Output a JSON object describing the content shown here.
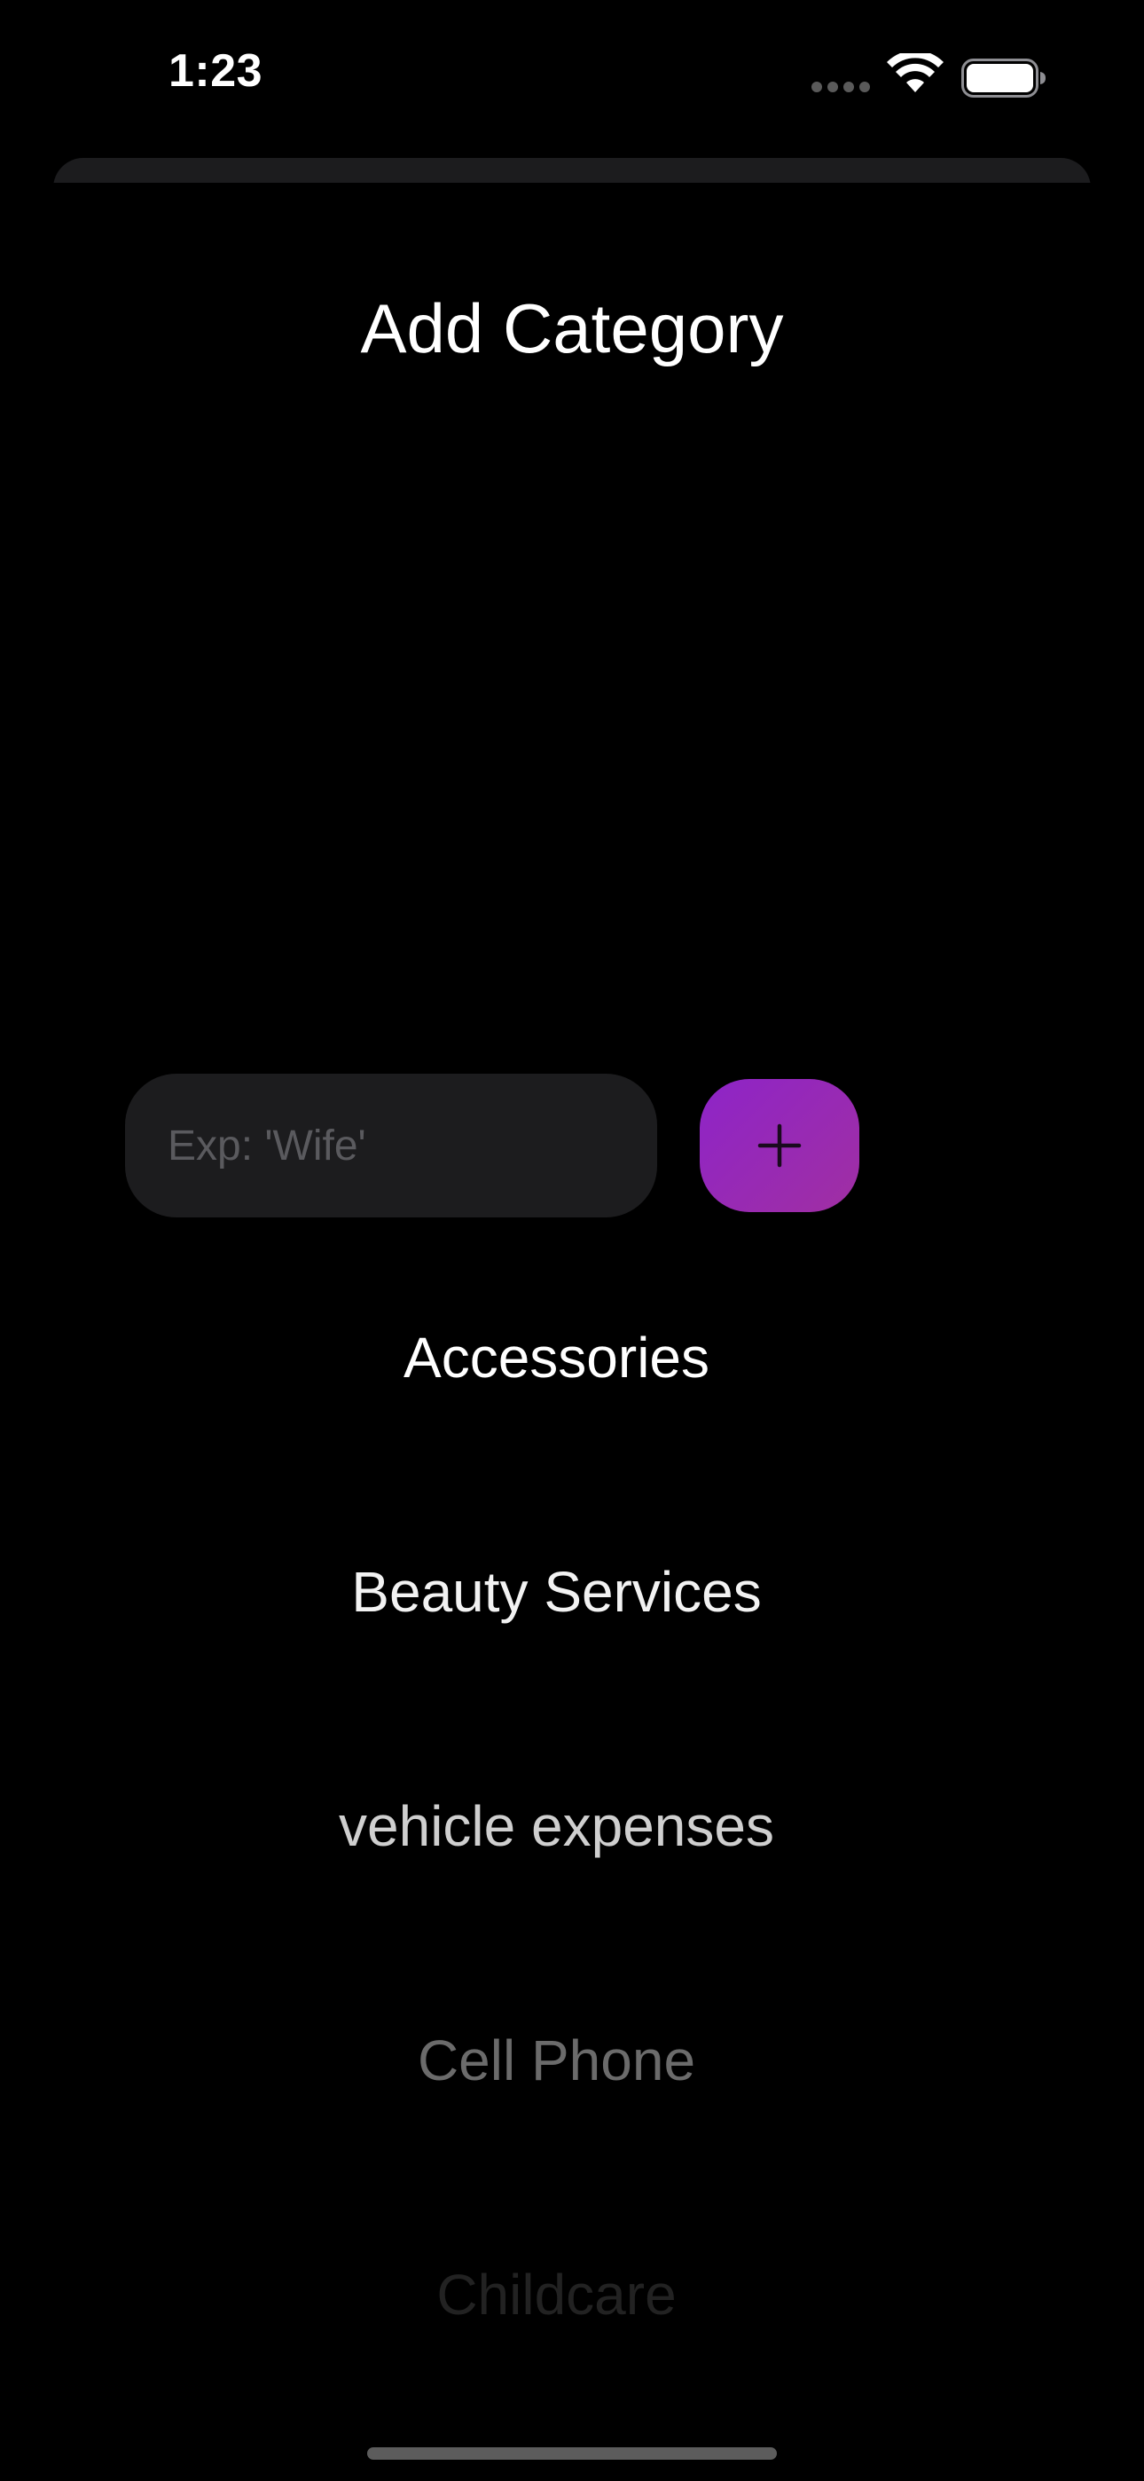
{
  "status_bar": {
    "time": "1:23",
    "icons": [
      "cellular-signal-icon",
      "wifi-icon",
      "battery-icon"
    ]
  },
  "header": {
    "title": "Add Category"
  },
  "form": {
    "input_value": "",
    "input_placeholder": "Exp: 'Wife'",
    "add_button_icon": "plus-icon",
    "add_button_color": "#9a27b8"
  },
  "categories": [
    "Accessories",
    "Beauty Services",
    "vehicle expenses",
    "Cell Phone",
    "Childcare"
  ],
  "colors": {
    "background": "#000000",
    "input_background": "#1c1c1e",
    "accent": "#9a27b8"
  }
}
